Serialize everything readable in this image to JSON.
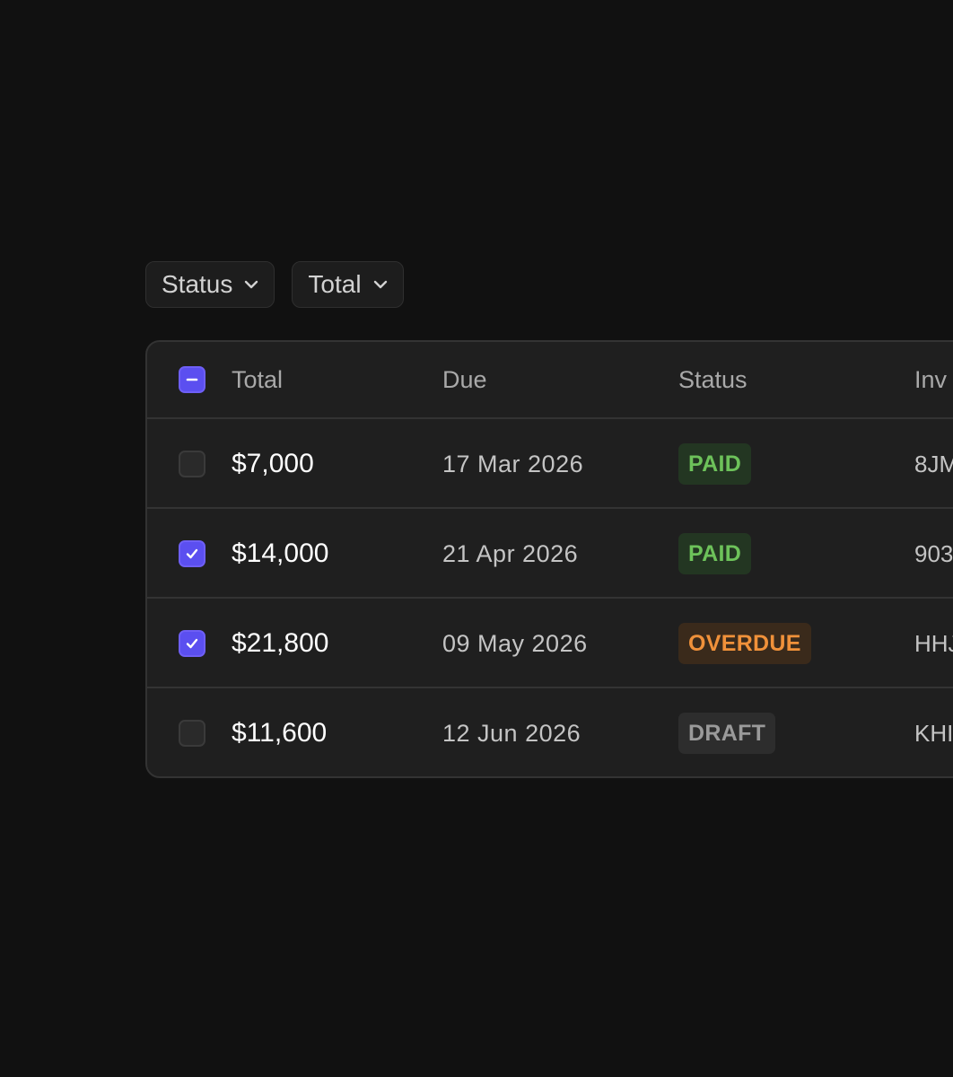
{
  "filters": [
    {
      "label": "Status",
      "icon": "chevron-down-icon"
    },
    {
      "label": "Total",
      "icon": "chevron-down-icon"
    }
  ],
  "table": {
    "header": {
      "select_all_state": "indeterminate",
      "columns": [
        "Total",
        "Due",
        "Status",
        "Inv"
      ]
    },
    "rows": [
      {
        "checked": false,
        "total": "$7,000",
        "due": "17 Mar 2026",
        "status": "PAID",
        "invoice": "8JM"
      },
      {
        "checked": true,
        "total": "$14,000",
        "due": "21 Apr 2026",
        "status": "PAID",
        "invoice": "903"
      },
      {
        "checked": true,
        "total": "$21,800",
        "due": "09 May 2026",
        "status": "OVERDUE",
        "invoice": "HHJ"
      },
      {
        "checked": false,
        "total": "$11,600",
        "due": "12 Jun 2026",
        "status": "DRAFT",
        "invoice": "KHI"
      }
    ]
  },
  "colors": {
    "background": "#111111",
    "table_bg": "#1f1f1f",
    "border": "#333333",
    "accent": "#5b4ff0",
    "paid_text": "#6dc25a",
    "paid_bg": "#233622",
    "overdue_text": "#f0913a",
    "overdue_bg": "#3a2a1b",
    "draft_text": "#9a9a9a",
    "draft_bg": "#2d2d2d"
  }
}
